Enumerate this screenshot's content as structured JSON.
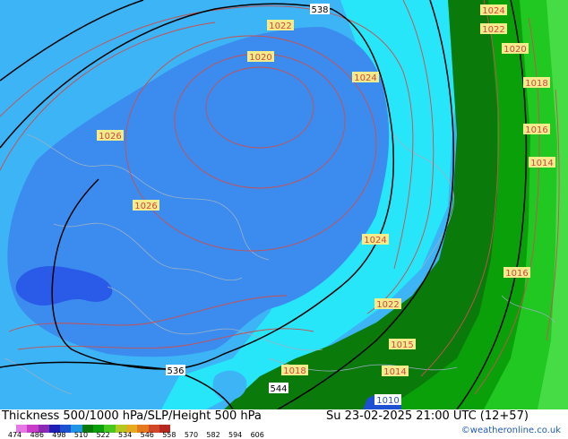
{
  "map": {
    "contour_label_color": "#d24646",
    "label_bg": "#f2ec8a",
    "geopotential_label_color": "#000000",
    "pressure_labels": [
      "1024",
      "1022",
      "1020",
      "1018",
      "1016",
      "1014",
      "1026",
      "1024",
      "1022",
      "1020",
      "1018",
      "1016",
      "1014",
      "1015",
      "1010",
      "1026",
      "1024",
      "1022"
    ],
    "height_labels": [
      "538",
      "536",
      "544"
    ],
    "colors": {
      "deep_blue": "#2a5ae8",
      "blue": "#3c8cf0",
      "light_blue": "#3cb4f5",
      "cyan": "#28e6fa",
      "dark_green": "#0a7a0a",
      "green": "#0aa00a",
      "light_green": "#22c822",
      "pale_green": "#46dc46",
      "coast": "#9ab0c4",
      "contour": "#c85050",
      "height_contour": "#000000"
    }
  },
  "footer": {
    "title": "Thickness 500/1000 hPa/SLP/Height 500 hPa",
    "valid": "Su 23-02-2025 21:00 UTC (12+57)",
    "credit": "©weatheronline.co.uk",
    "legend_ticks": [
      "474",
      "486",
      "498",
      "510",
      "522",
      "534",
      "546",
      "558",
      "570",
      "582",
      "594",
      "606"
    ],
    "legend_colors": [
      "#e678e6",
      "#c83cc8",
      "#8c28b4",
      "#1e1eb4",
      "#1e50d2",
      "#1e96e6",
      "#0a7a0a",
      "#0aa00a",
      "#46c81e",
      "#b4c81e",
      "#e6aa1e",
      "#e6781e",
      "#d24628",
      "#b4281e"
    ]
  }
}
